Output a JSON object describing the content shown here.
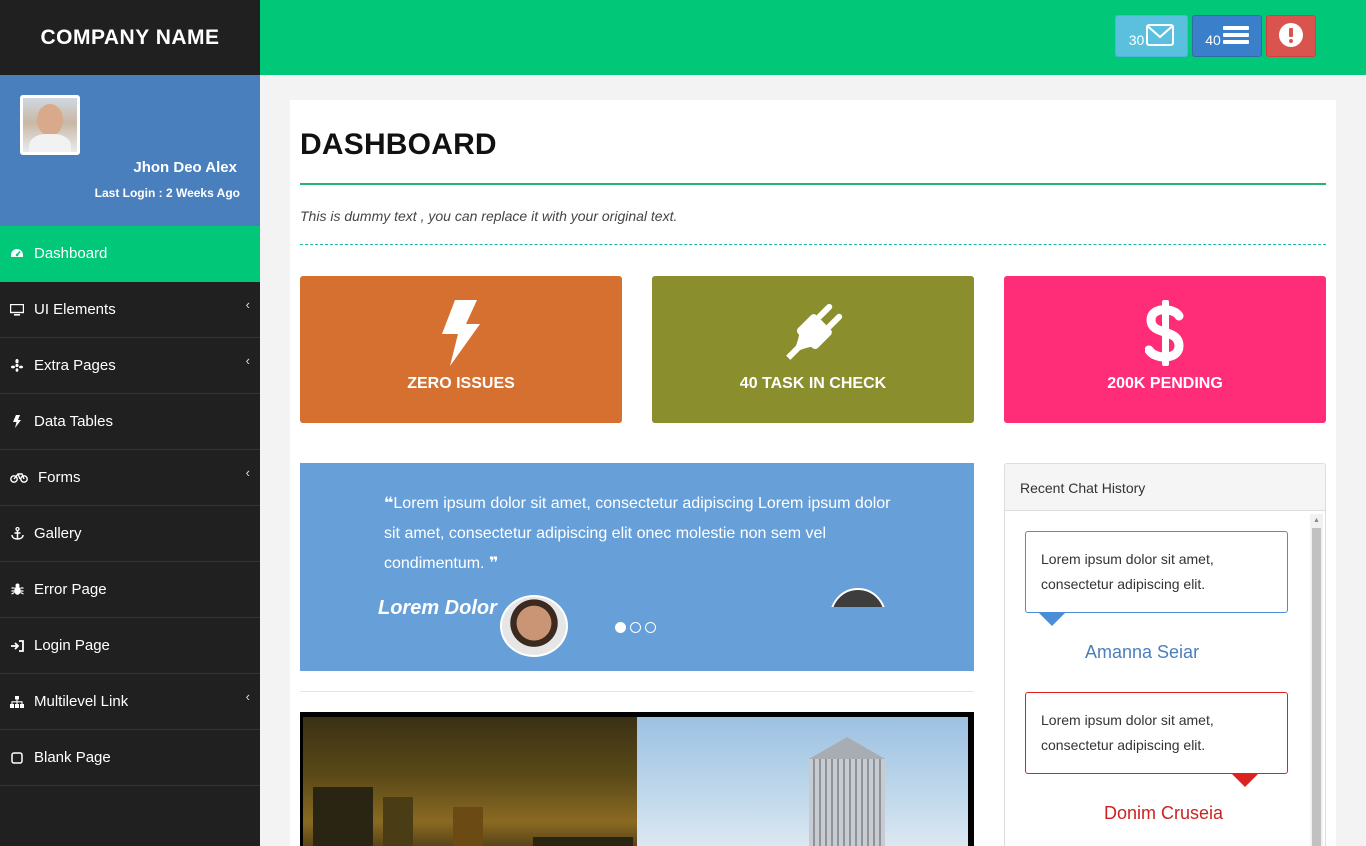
{
  "brand": "COMPANY NAME",
  "user": {
    "name": "Jhon Deo Alex",
    "last_login": "Last Login : 2 Weeks Ago"
  },
  "menu": [
    {
      "label": "Dashboard",
      "icon": "dashboard-icon",
      "active": true
    },
    {
      "label": "UI Elements",
      "icon": "desktop-icon",
      "submenu": true
    },
    {
      "label": "Extra Pages",
      "icon": "yelp-icon",
      "submenu": true
    },
    {
      "label": "Data Tables",
      "icon": "bolt-icon"
    },
    {
      "label": "Forms",
      "icon": "bicycle-icon",
      "submenu": true
    },
    {
      "label": "Gallery",
      "icon": "anchor-icon"
    },
    {
      "label": "Error Page",
      "icon": "bug-icon"
    },
    {
      "label": "Login Page",
      "icon": "sign-in-icon"
    },
    {
      "label": "Multilevel Link",
      "icon": "sitemap-icon",
      "submenu": true
    },
    {
      "label": "Blank Page",
      "icon": "square-icon"
    }
  ],
  "topbar": {
    "mail_count": "30",
    "list_count": "40",
    "colors": {
      "bar": "#00c878",
      "mail": "#5bc0de",
      "list": "#3a7fca",
      "alert": "#d9534f"
    }
  },
  "page": {
    "title": "DASHBOARD",
    "subtitle": "This is dummy text , you can replace it with your original text."
  },
  "tiles": [
    {
      "label": "ZERO ISSUES",
      "icon": "bolt-icon",
      "color": "#d67030"
    },
    {
      "label": "40 TASK IN CHECK",
      "icon": "plug-icon",
      "color": "#8a8e2c"
    },
    {
      "label": "200K PENDING",
      "icon": "dollar-icon",
      "color": "#ff2d77"
    }
  ],
  "quote": {
    "open_mark": "❝",
    "text": "Lorem ipsum dolor sit amet, consectetur adipiscing Lorem ipsum dolor sit amet, consectetur adipiscing elit onec molestie non sem vel condimentum.",
    "close_mark": "❞",
    "author": "Lorem Dolor",
    "active_slide": 1,
    "slide_count": 3
  },
  "chat": {
    "title": "Recent Chat History",
    "messages": [
      {
        "text": "Lorem ipsum dolor sit amet, consectetur adipiscing elit.",
        "name": "Amanna Seiar"
      },
      {
        "text": "Lorem ipsum dolor sit amet, consectetur adipiscing elit.",
        "name": "Donim Cruseia"
      }
    ]
  }
}
